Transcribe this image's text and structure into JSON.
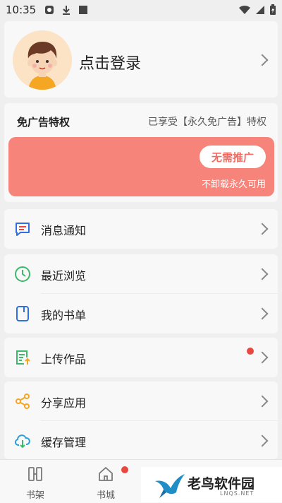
{
  "status_bar": {
    "time": "10:35"
  },
  "profile": {
    "login_label": "点击登录"
  },
  "ad_free": {
    "title": "免广告特权",
    "status": "已享受【永久免广告】特权",
    "promo_button": "无需推广",
    "promo_note": "不卸载永久可用"
  },
  "menu": {
    "notifications": "消息通知",
    "recent": "最近浏览",
    "my_booklist": "我的书单",
    "upload": "上传作品",
    "share": "分享应用",
    "cache": "缓存管理"
  },
  "tabs": [
    {
      "label": "书架"
    },
    {
      "label": "书城"
    }
  ],
  "watermark": {
    "text": "老鸟软件园",
    "sub": "LNQS.NET"
  },
  "colors": {
    "promo": "#f7847b",
    "badge": "#e8483f",
    "accent_blue": "#2f6fe0"
  }
}
